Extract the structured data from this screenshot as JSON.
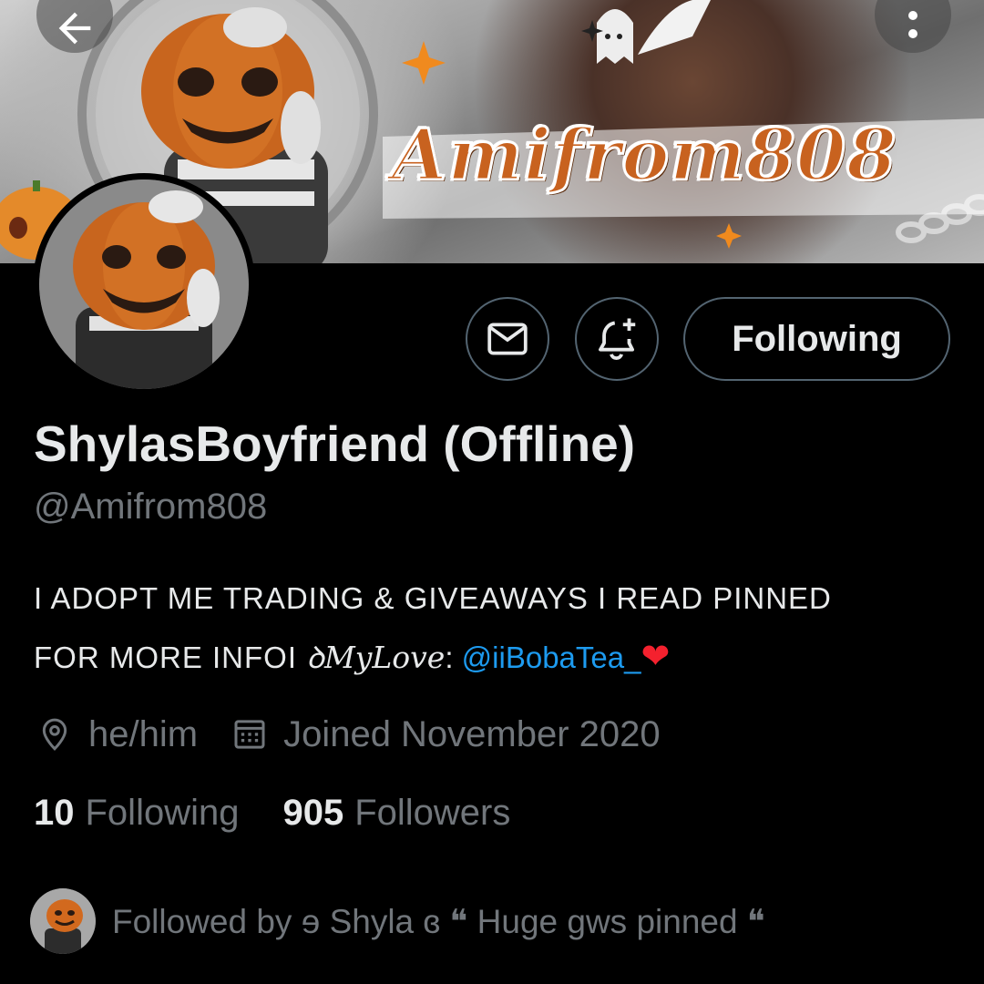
{
  "banner": {
    "logo_text": "Amifrom808"
  },
  "actions": {
    "follow_label": "Following"
  },
  "profile": {
    "display_name": "ShylasBoyfriend (Offline)",
    "handle": "@Amifrom808",
    "bio_line1": "I ADOPT ME TRADING & GIVEAWAYS I READ PINNED",
    "bio_line2_prefix": "FOR MORE INFOI ",
    "bio_line2_script": "ꝺMyLove",
    "bio_line2_colon": ": ",
    "bio_mention": "@iiBobaTea_",
    "bio_heart": "❤",
    "pronouns": "he/him",
    "joined": "Joined November 2020"
  },
  "stats": {
    "following_count": "10",
    "following_label": "Following",
    "followers_count": "905",
    "followers_label": "Followers"
  },
  "followed_by": {
    "text": "Followed by ɘ Shyla ɞ ❝ Huge gws pinned ❝"
  },
  "icons": {
    "back": "arrow-left-icon",
    "more": "more-vertical-icon",
    "message": "mail-icon",
    "notify": "bell-plus-icon",
    "location": "location-pin-icon",
    "calendar": "calendar-icon"
  },
  "colors": {
    "background": "#000000",
    "text_primary": "#e7e9ea",
    "text_secondary": "#71767b",
    "link": "#1d9bf0",
    "border": "#536471",
    "heart": "#f4212e"
  }
}
